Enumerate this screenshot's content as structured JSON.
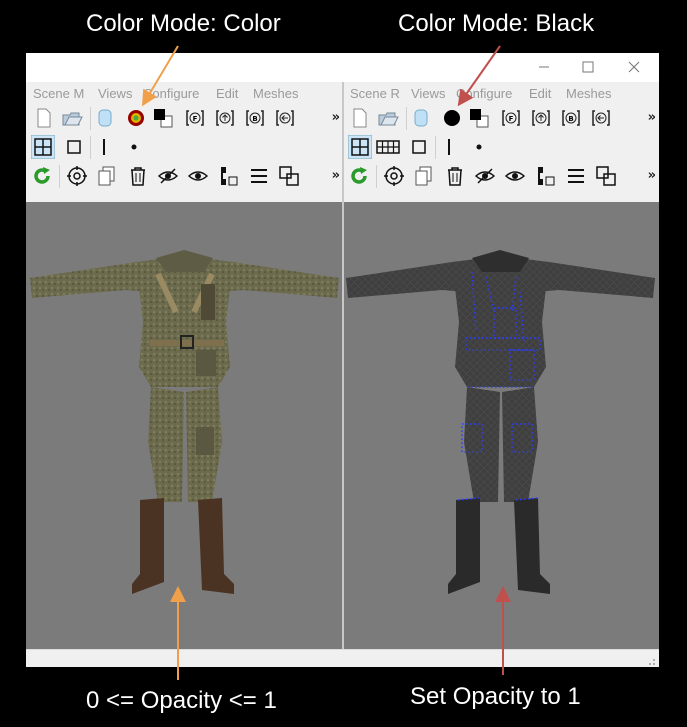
{
  "annotations": {
    "left_top": "Color Mode: Color",
    "right_top": "Color Mode: Black",
    "left_bottom": "0 <= Opacity <= 1",
    "right_bottom": "Set Opacity to 1"
  },
  "window": {
    "controls": [
      "minimize",
      "maximize",
      "close"
    ]
  },
  "left_pane": {
    "menu": [
      "Scene M",
      "Views",
      "Configure",
      "Edit",
      "Meshes"
    ],
    "color_mode": "color",
    "overflow": "»"
  },
  "right_pane": {
    "menu": [
      "Scene R",
      "Views",
      "Configure",
      "Edit",
      "Meshes"
    ],
    "color_mode": "black",
    "overflow": "»"
  },
  "colors": {
    "annotation_left": "#f0a04b",
    "annotation_right": "#c0504d",
    "viewport_bg": "#7b7b7b"
  }
}
